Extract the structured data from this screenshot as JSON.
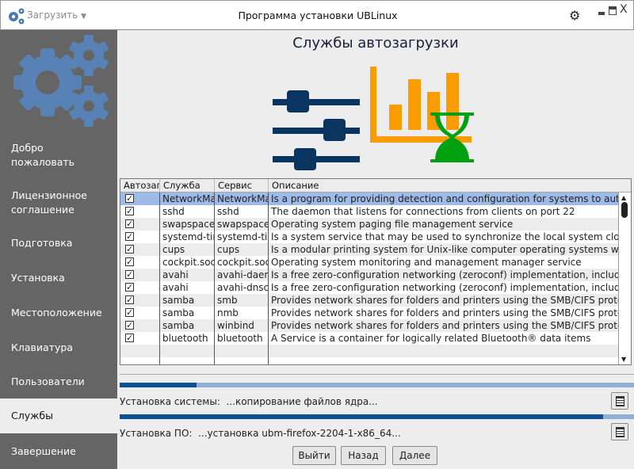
{
  "window": {
    "title": "Программа установки UBLinux",
    "load_menu": "Загрузить"
  },
  "sidebar": {
    "items": [
      {
        "label": "Добро\nпожаловать"
      },
      {
        "label": "Лицензионное\nсоглашение"
      },
      {
        "label": "Подготовка"
      },
      {
        "label": "Установка"
      },
      {
        "label": "Местоположение"
      },
      {
        "label": "Клавиатура"
      },
      {
        "label": "Пользователи"
      },
      {
        "label": "Службы",
        "selected": true
      },
      {
        "label": "Завершение"
      }
    ]
  },
  "page": {
    "title": "Службы автозагрузки"
  },
  "table": {
    "columns": [
      "Автозагрузка",
      "Служба",
      "Сервис",
      "Описание"
    ],
    "rows": [
      {
        "checked": true,
        "service": "NetworkManager",
        "unit": "NetworkManager",
        "desc": "Is a program for providing detection and configuration for systems to automatically connect to networks"
      },
      {
        "checked": true,
        "service": "sshd",
        "unit": "sshd",
        "desc": "The daemon that listens for connections from clients on port 22"
      },
      {
        "checked": true,
        "service": "swapspace",
        "unit": "swapspace",
        "desc": "Operating system paging file management service"
      },
      {
        "checked": true,
        "service": "systemd-timesyncd",
        "unit": "systemd-timesyncd",
        "desc": "Is a system service that may be used to synchronize the local system clock"
      },
      {
        "checked": true,
        "service": "cups",
        "unit": "cups",
        "desc": "Is a modular printing system for Unix-like computer operating systems which"
      },
      {
        "checked": true,
        "service": "cockpit.socket",
        "unit": "cockpit.socket",
        "desc": "Operating system monitoring and management manager service"
      },
      {
        "checked": true,
        "service": "avahi",
        "unit": "avahi-daemon",
        "desc": "Is a free zero-configuration networking (zeroconf) implementation, including"
      },
      {
        "checked": true,
        "service": "avahi",
        "unit": "avahi-dnsconfd",
        "desc": "Is a free zero-configuration networking (zeroconf) implementation, including"
      },
      {
        "checked": true,
        "service": "samba",
        "unit": "smb",
        "desc": "Provides network shares for folders and printers using the SMB/CIFS protocol"
      },
      {
        "checked": true,
        "service": "samba",
        "unit": "nmb",
        "desc": "Provides network shares for folders and printers using the SMB/CIFS protocol"
      },
      {
        "checked": true,
        "service": "samba",
        "unit": "winbind",
        "desc": "Provides network shares for folders and printers using the SMB/CIFS protocol"
      },
      {
        "checked": true,
        "service": "bluetooth",
        "unit": "bluetooth",
        "desc": "A Service is a container for logically related Bluetooth® data items"
      }
    ]
  },
  "progress": {
    "system": {
      "label": "Установка системы:",
      "status": "...копирование файлов ядра...",
      "fraction": 0.15
    },
    "software": {
      "label": "Установка ПО:",
      "status": "...установка ubm-firefox-2204-1-x86_64...",
      "fraction": 0.94
    }
  },
  "buttons": {
    "quit": "Выйти",
    "back": "Назад",
    "next": "Далее"
  },
  "colors": {
    "sidebar": "#656565",
    "accent": "#0d5294",
    "gears": "#5882b5",
    "sliders": "#0a3561",
    "chart": "#f99c00",
    "hourglass": "#00a010"
  }
}
